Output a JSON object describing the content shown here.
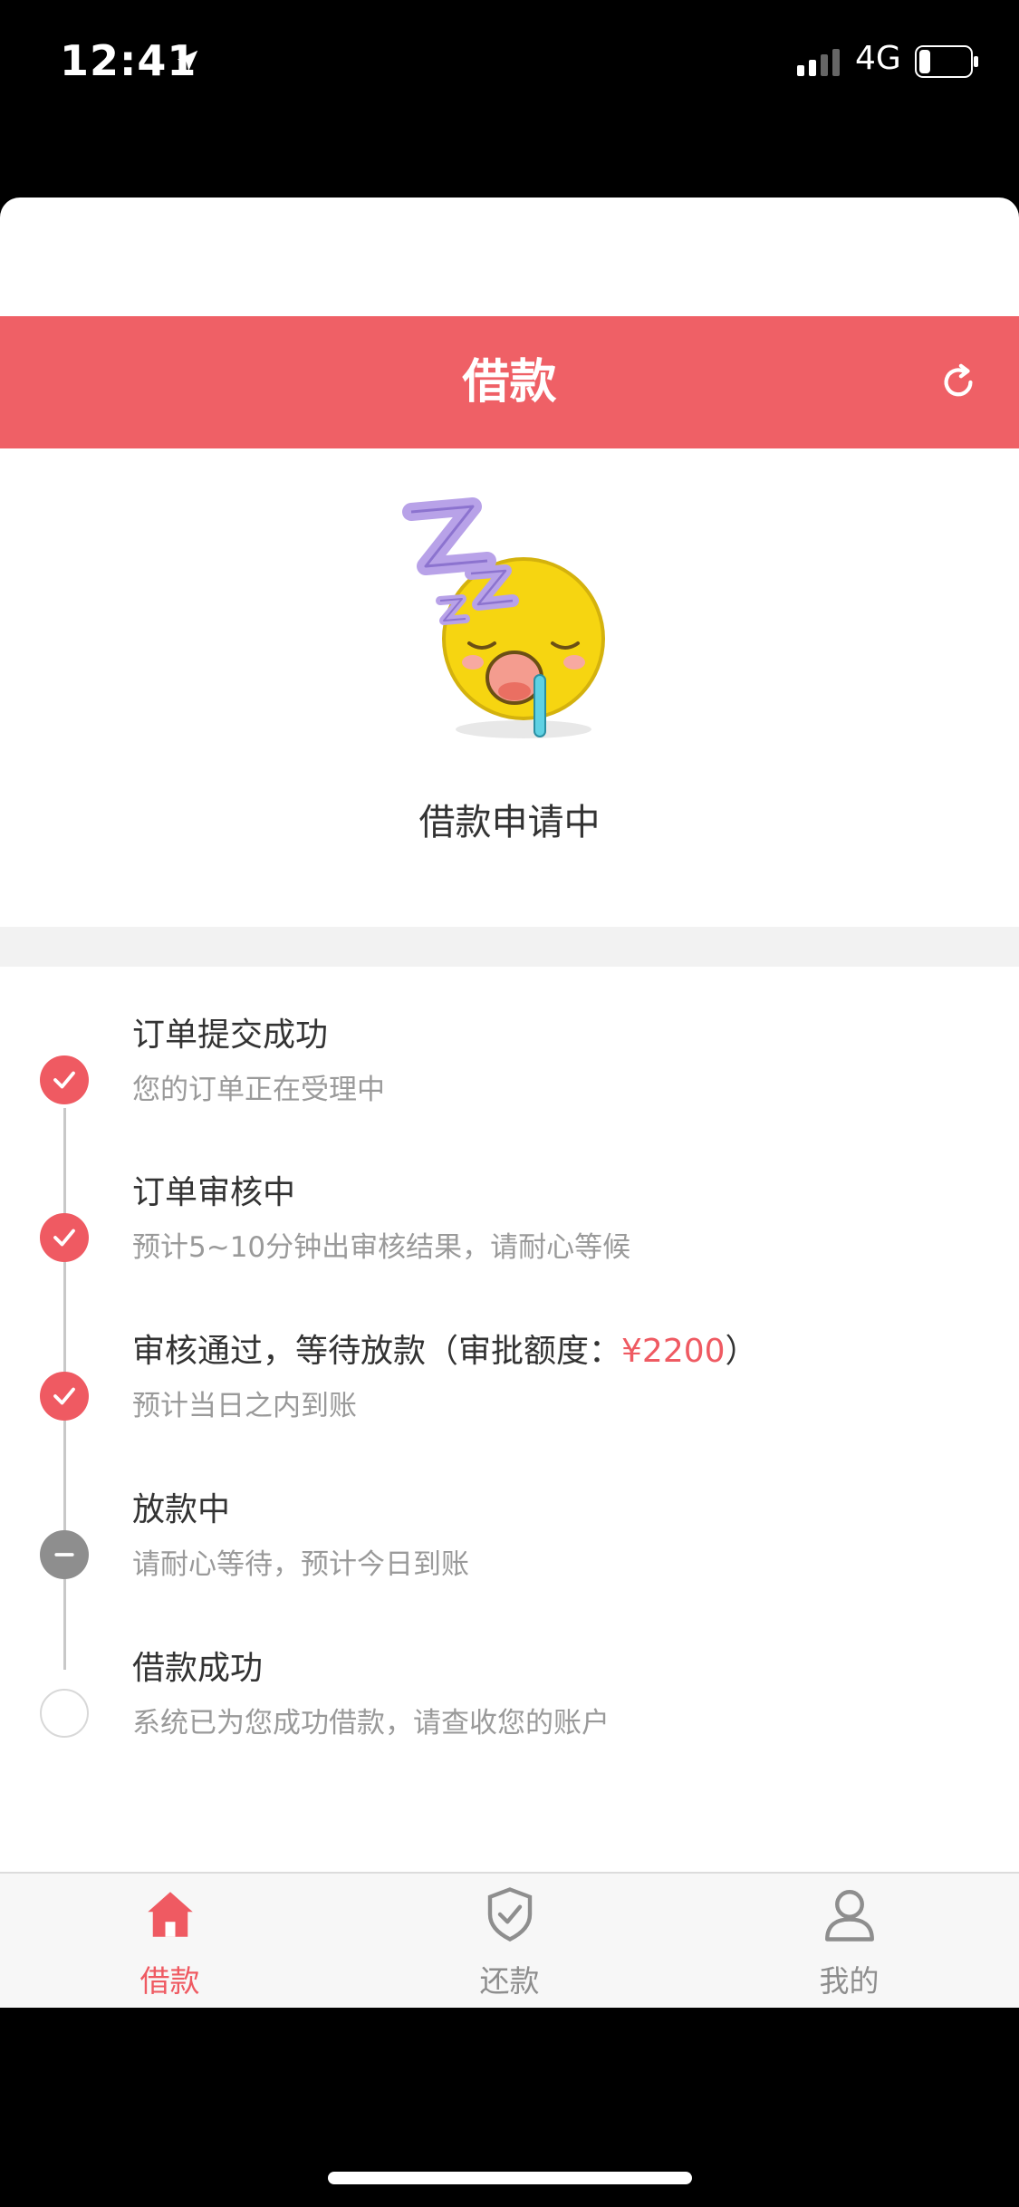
{
  "status_bar": {
    "time": "12:41",
    "network": "4G"
  },
  "nav": {
    "title": "借款"
  },
  "hero": {
    "status_text": "借款申请中"
  },
  "steps": [
    {
      "title": "订单提交成功",
      "desc": "您的订单正在受理中",
      "state": "done"
    },
    {
      "title": "订单审核中",
      "desc": "预计5~10分钟出审核结果，请耐心等候",
      "state": "done"
    },
    {
      "title_prefix": "审核通过，等待放款（审批额度：",
      "amount": "¥2200",
      "title_suffix": "）",
      "desc": "预计当日之内到账",
      "state": "done"
    },
    {
      "title": "放款中",
      "desc": "请耐心等待，预计今日到账",
      "state": "active"
    },
    {
      "title": "借款成功",
      "desc": "系统已为您成功借款，请查收您的账户",
      "state": "pending"
    }
  ],
  "tabs": [
    {
      "label": "借款",
      "icon": "home-icon",
      "active": true
    },
    {
      "label": "还款",
      "icon": "shield-check-icon",
      "active": false
    },
    {
      "label": "我的",
      "icon": "user-icon",
      "active": false
    }
  ],
  "colors": {
    "accent": "#ef6066",
    "done": "#ef5a62",
    "active_marker": "#8e8e8e"
  }
}
